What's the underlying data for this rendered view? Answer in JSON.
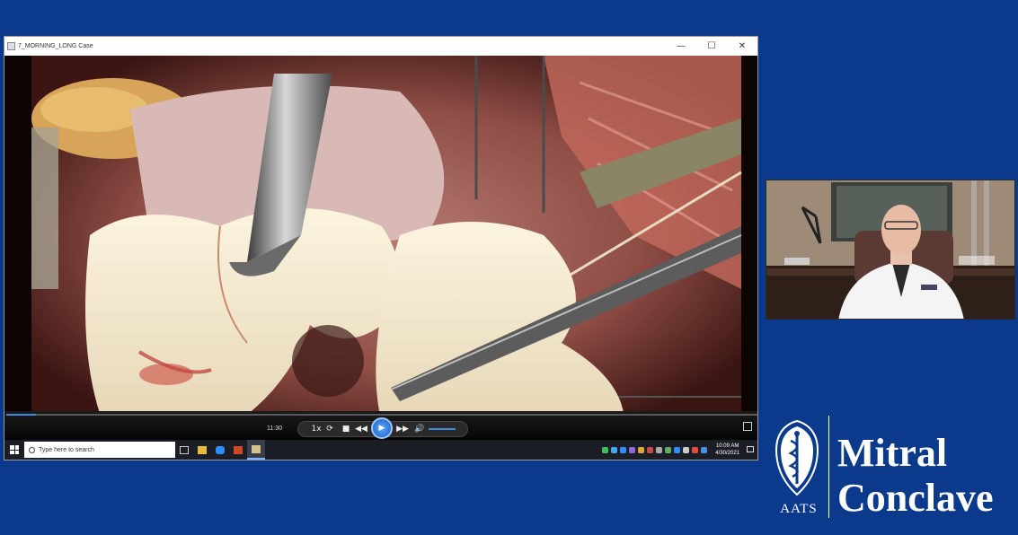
{
  "window": {
    "title": "7_MORNING_LONG Case",
    "controls": [
      "—",
      "☐",
      "✕"
    ]
  },
  "player": {
    "time": "11:30",
    "progress": 0.04,
    "controls": {
      "rate": "1x",
      "stop": "■",
      "rewind": "◀◀",
      "play": "▶",
      "forward": "▶▶",
      "volume": "🔊"
    }
  },
  "taskbar": {
    "search_placeholder": "Type here to search",
    "clock_time": "10:09 AM",
    "clock_date": "4/30/2021",
    "apps": [
      "task-view",
      "file-explorer",
      "zoom",
      "powerpoint",
      "media-player"
    ]
  },
  "branding": {
    "org": "AATS",
    "line1": "Mitral",
    "line2": "Conclave"
  },
  "colors": {
    "background": "#0b3a8c",
    "accent": "#3d8be0"
  }
}
